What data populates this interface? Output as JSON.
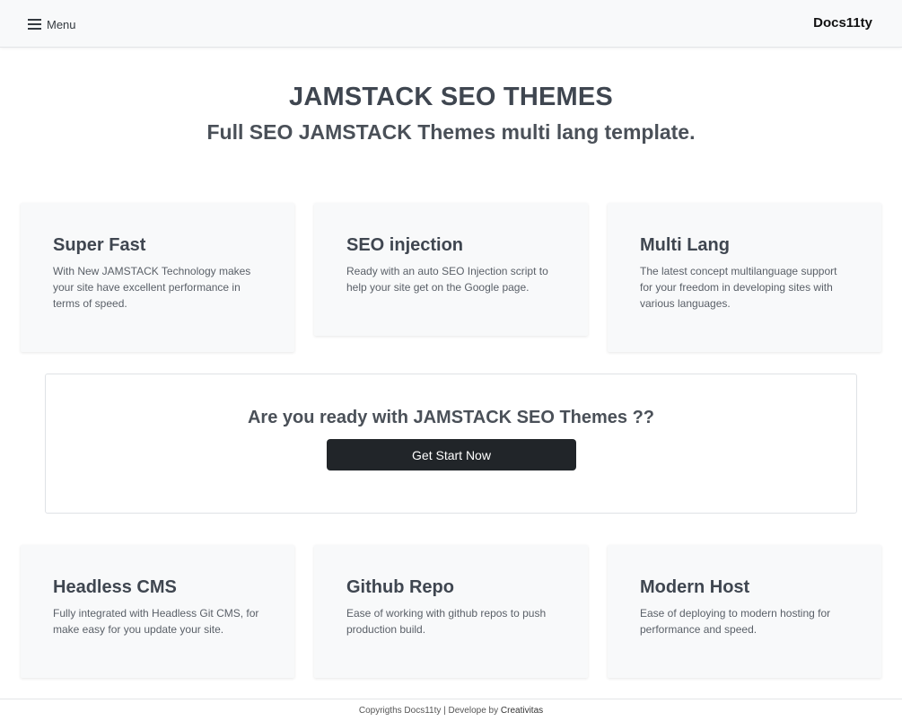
{
  "header": {
    "menu_label": "Menu",
    "brand": "Docs11ty"
  },
  "hero": {
    "title": "JAMSTACK SEO THEMES",
    "subtitle": "Full SEO JAMSTACK Themes multi lang template."
  },
  "features_top": [
    {
      "title": "Super Fast",
      "text": "With New JAMSTACK Technology makes your site have excellent performance in terms of speed."
    },
    {
      "title": "SEO injection",
      "text": "Ready with an auto SEO Injection script to help your site get on the Google page."
    },
    {
      "title": "Multi Lang",
      "text": "The latest concept multilanguage support for your freedom in developing sites with various languages."
    }
  ],
  "cta": {
    "title": "Are you ready with JAMSTACK SEO Themes ??",
    "button_label": "Get Start Now"
  },
  "features_bottom": [
    {
      "title": "Headless CMS",
      "text": "Fully integrated with Headless Git CMS, for make easy for you update your site."
    },
    {
      "title": "Github Repo",
      "text": "Ease of working with github repos to push production build."
    },
    {
      "title": "Modern Host",
      "text": "Ease of deploying to modern hosting for performance and speed."
    }
  ],
  "footer": {
    "copyright": "Copyrigths Docs11ty | Develope by ",
    "author_link": "Creativitas"
  },
  "colors": {
    "topbar_bg": "#f8f9fa",
    "card_bg": "#f8f9fa",
    "button_bg": "#212529",
    "heading": "#3f4650"
  },
  "icons": {
    "menu": "hamburger-icon"
  }
}
